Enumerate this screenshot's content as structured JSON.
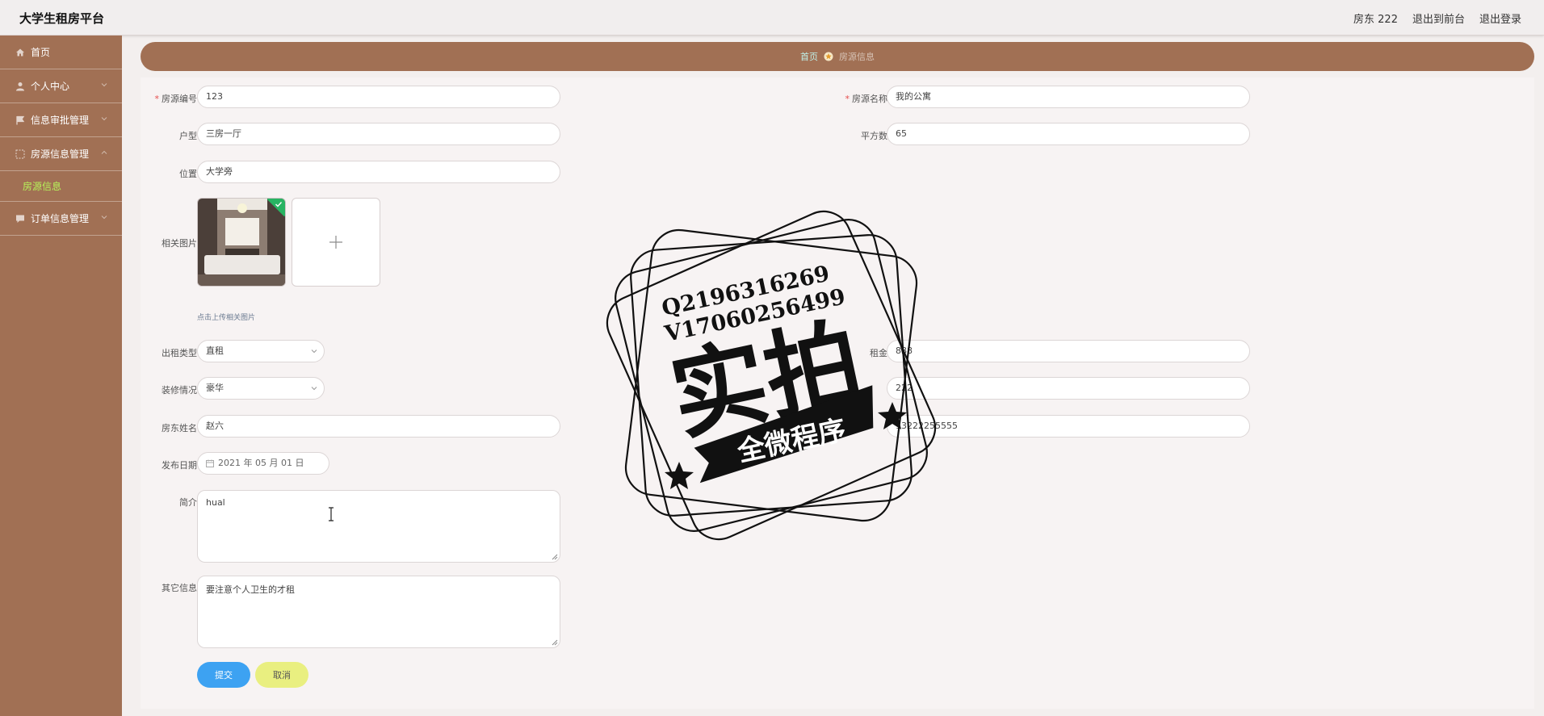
{
  "app": {
    "title": "大学生租房平台",
    "user_label": "房东 222",
    "to_front_label": "退出到前台",
    "logout_label": "退出登录"
  },
  "sidebar": {
    "items": [
      {
        "label": "首页",
        "icon": "home-icon"
      },
      {
        "label": "个人中心",
        "icon": "user-icon"
      },
      {
        "label": "信息审批管理",
        "icon": "flag-icon"
      },
      {
        "label": "房源信息管理",
        "icon": "grid-icon",
        "children": [
          {
            "label": "房源信息",
            "active": true
          }
        ]
      },
      {
        "label": "订单信息管理",
        "icon": "chat-icon"
      }
    ]
  },
  "breadcrumb": {
    "home": "首页",
    "current": "房源信息"
  },
  "form": {
    "house_no": {
      "label": "房源编号",
      "value": "123",
      "required": true
    },
    "house_name": {
      "label": "房源名称",
      "value": "我的公寓",
      "required": true
    },
    "layout": {
      "label": "户型",
      "value": "三房一厅"
    },
    "area": {
      "label": "平方数",
      "value": "65"
    },
    "location": {
      "label": "位置",
      "value": "大学旁"
    },
    "photos": {
      "label": "相关图片",
      "hint": "点击上传相关图片"
    },
    "rent_type": {
      "label": "出租类型",
      "value": "直租"
    },
    "rent": {
      "label": "租金",
      "value": "888"
    },
    "decoration": {
      "label": "装修情况",
      "value": "豪华"
    },
    "landlord_account": {
      "value": "222"
    },
    "landlord_name": {
      "label": "房东姓名",
      "value": "赵六"
    },
    "landlord_phone": {
      "value": "13222255555"
    },
    "publish_date": {
      "label": "发布日期",
      "value": "2021 年 05 月 01 日"
    },
    "intro": {
      "label": "简介",
      "value": "hual"
    },
    "other": {
      "label": "其它信息",
      "value": "要注意个人卫生的才租"
    }
  },
  "actions": {
    "submit": "提交",
    "cancel": "取消"
  },
  "watermark": {
    "line1": "Q2196316269",
    "line2": "V17060256499",
    "big": "实拍",
    "banner": "全微程序"
  },
  "colors": {
    "sidebar": "#a17054",
    "accent_submit": "#3da2f2",
    "accent_cancel": "#e9ef80",
    "active_menu": "#b6f25a"
  }
}
